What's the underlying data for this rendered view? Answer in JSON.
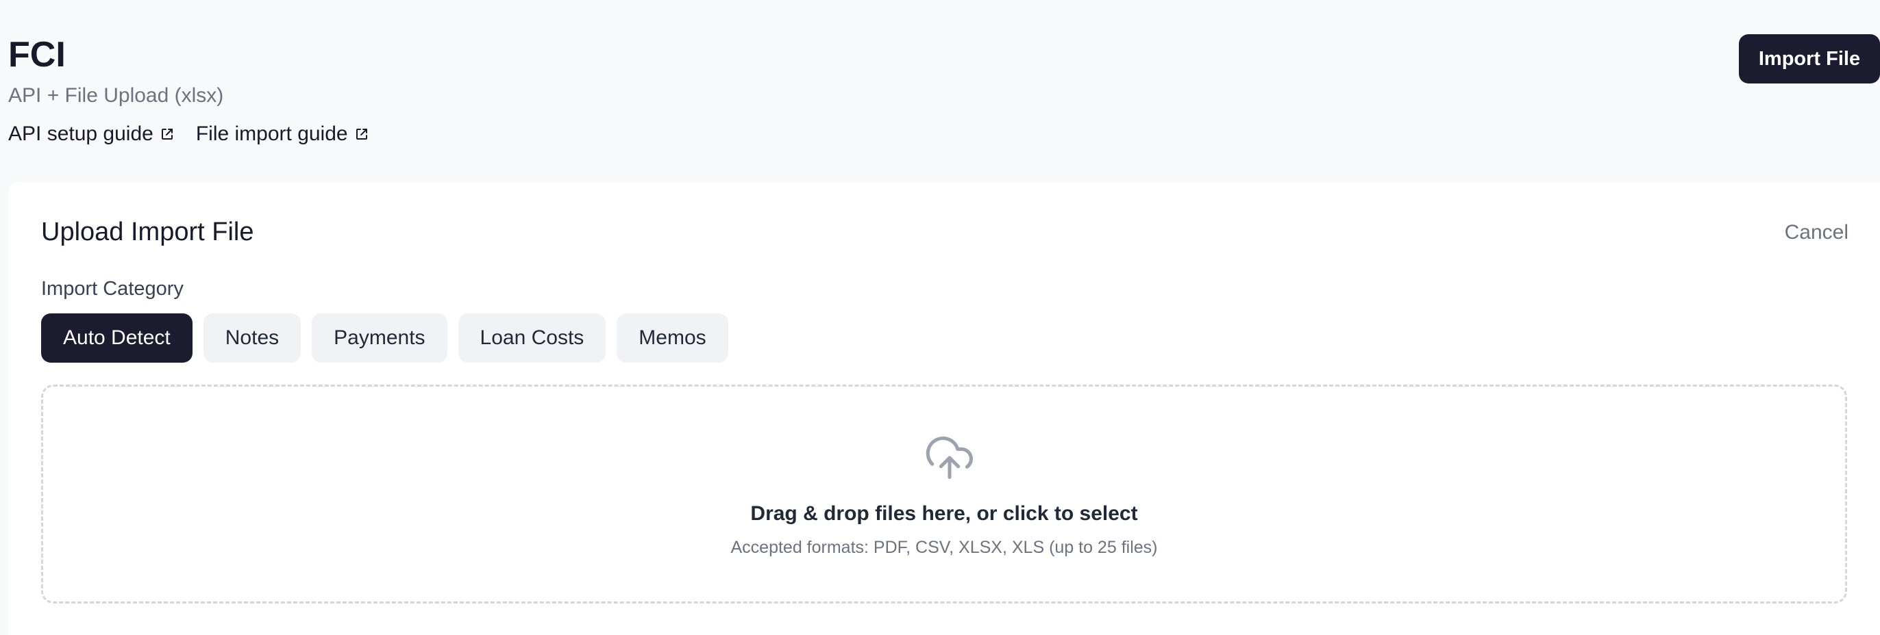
{
  "header": {
    "title": "FCI",
    "subtitle": "API + File Upload (xlsx)",
    "links": [
      {
        "label": "API setup guide",
        "icon": "external-link-icon"
      },
      {
        "label": "File import guide",
        "icon": "external-link-icon"
      }
    ],
    "import_button": "Import File"
  },
  "card": {
    "title": "Upload Import File",
    "cancel": "Cancel",
    "category_label": "Import Category",
    "categories": [
      {
        "label": "Auto Detect",
        "active": true
      },
      {
        "label": "Notes",
        "active": false
      },
      {
        "label": "Payments",
        "active": false
      },
      {
        "label": "Loan Costs",
        "active": false
      },
      {
        "label": "Memos",
        "active": false
      }
    ],
    "dropzone": {
      "icon": "cloud-upload-icon",
      "main_text": "Drag & drop files here, or click to select",
      "sub_text": "Accepted formats: PDF, CSV, XLSX, XLS (up to 25 files)"
    }
  },
  "colors": {
    "primary_dark": "#1b1c30",
    "background": "#f8f9fb",
    "muted_text": "#6b7280",
    "chip_bg": "#f1f2f5"
  }
}
